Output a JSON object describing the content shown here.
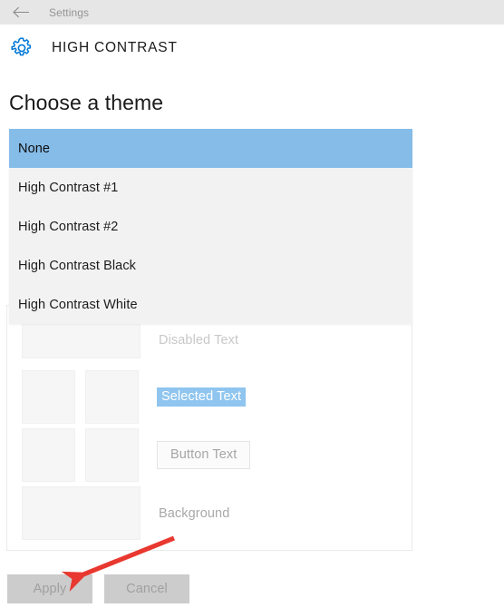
{
  "window": {
    "titlebar_label": "Settings",
    "back_icon": "back-arrow-icon"
  },
  "header": {
    "icon": "gear-icon",
    "title": "HIGH CONTRAST",
    "accent_color": "#0078d7"
  },
  "main": {
    "page_title": "Choose a theme",
    "dropdown": {
      "expanded": true,
      "selected_value": "None",
      "highlight_color": "#86bce8",
      "background_color": "#f2f2f2",
      "options": [
        {
          "label": "None",
          "selected": true
        },
        {
          "label": "High Contrast #1",
          "selected": false
        },
        {
          "label": "High Contrast #2",
          "selected": false
        },
        {
          "label": "High Contrast Black",
          "selected": false
        },
        {
          "label": "High Contrast White",
          "selected": false
        }
      ]
    },
    "preview": {
      "rows": [
        {
          "name": "disabled-text",
          "label": "Disabled Text",
          "swatches": 1
        },
        {
          "name": "selected-text",
          "label": "Selected Text",
          "swatches": 2
        },
        {
          "name": "button-text",
          "label": "Button Text",
          "swatches": 2
        },
        {
          "name": "background",
          "label": "Background",
          "swatches": 1
        }
      ],
      "selected_text_highlight": "#8fc5ef",
      "swatch_color": "#f6f6f6"
    }
  },
  "footer": {
    "apply_label": "Apply",
    "cancel_label": "Cancel",
    "apply_enabled": false,
    "cancel_enabled": false
  },
  "annotation": {
    "type": "red-arrow",
    "color": "#e8382f",
    "points_to": "Apply"
  }
}
